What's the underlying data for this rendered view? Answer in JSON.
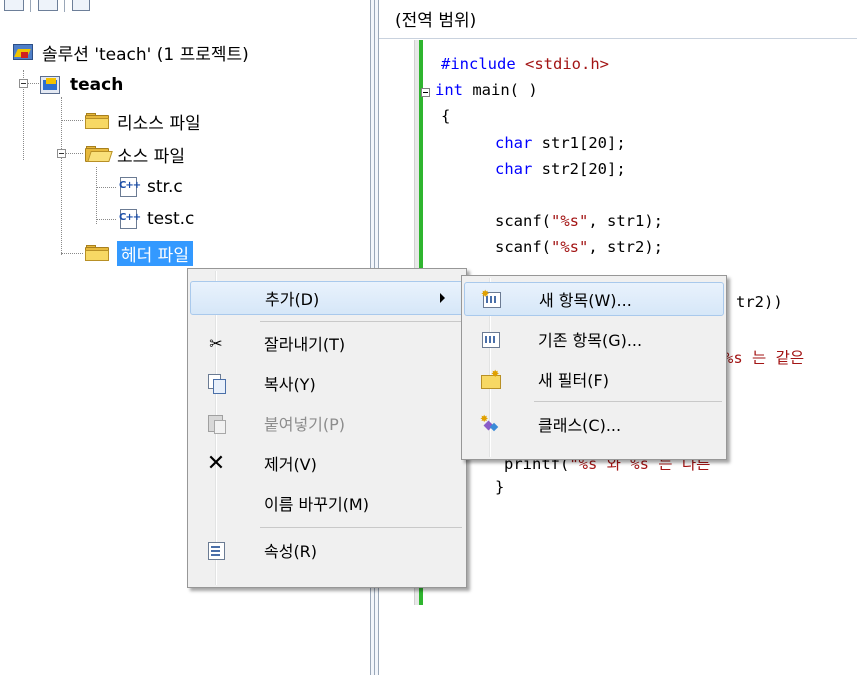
{
  "explorer": {
    "solution_label": "솔루션 'teach' (1 프로젝트)",
    "project_label": "teach",
    "items": [
      {
        "label": "리소스 파일",
        "icon": "folder-icon"
      },
      {
        "label": "소스 파일",
        "icon": "open-folder-icon"
      },
      {
        "label": "str.c",
        "icon": "c-file-icon"
      },
      {
        "label": "test.c",
        "icon": "c-file-icon"
      },
      {
        "label": "헤더 파일",
        "icon": "folder-icon"
      }
    ],
    "cpp_badge": "C++"
  },
  "editor": {
    "scope_label": "(전역 범위)",
    "lines": [
      {
        "kw": "#include",
        "rest": " ",
        "str": "<stdio.h>"
      },
      {
        "kw": "int",
        "rest": " main( )"
      },
      {
        "plain": "{"
      },
      {
        "kw": "char",
        "rest": " str1[20];"
      },
      {
        "kw": "char",
        "rest": " str2[20];"
      },
      {
        "pre": "scanf(",
        "str": "\"%s\"",
        "post": ", str1);"
      },
      {
        "pre": "scanf(",
        "str": "\"%s\"",
        "post": ", str2);"
      },
      {
        "plain": "tr2))"
      },
      {
        "str": "%s 는 같은"
      },
      {
        "pre": "printf(",
        "str": "\"%s 와 %s 는 다른"
      },
      {
        "plain": "}"
      }
    ]
  },
  "context_menu": {
    "items": [
      {
        "label": "추가(D)",
        "icon": "none",
        "submenu": true
      },
      {
        "label": "잘라내기(T)",
        "icon": "scissors-icon"
      },
      {
        "label": "복사(Y)",
        "icon": "copy-icon"
      },
      {
        "label": "붙여넣기(P)",
        "icon": "paste-icon",
        "disabled": true
      },
      {
        "label": "제거(V)",
        "icon": "delete-x-icon"
      },
      {
        "label": "이름 바꾸기(M)",
        "icon": "none"
      },
      {
        "label": "속성(R)",
        "icon": "properties-icon"
      }
    ]
  },
  "submenu": {
    "items": [
      {
        "label": "새 항목(W)...",
        "icon": "new-item-icon"
      },
      {
        "label": "기존 항목(G)...",
        "icon": "existing-item-icon"
      },
      {
        "label": "새 필터(F)",
        "icon": "new-filter-icon"
      },
      {
        "label": "클래스(C)...",
        "icon": "class-icon"
      }
    ]
  }
}
